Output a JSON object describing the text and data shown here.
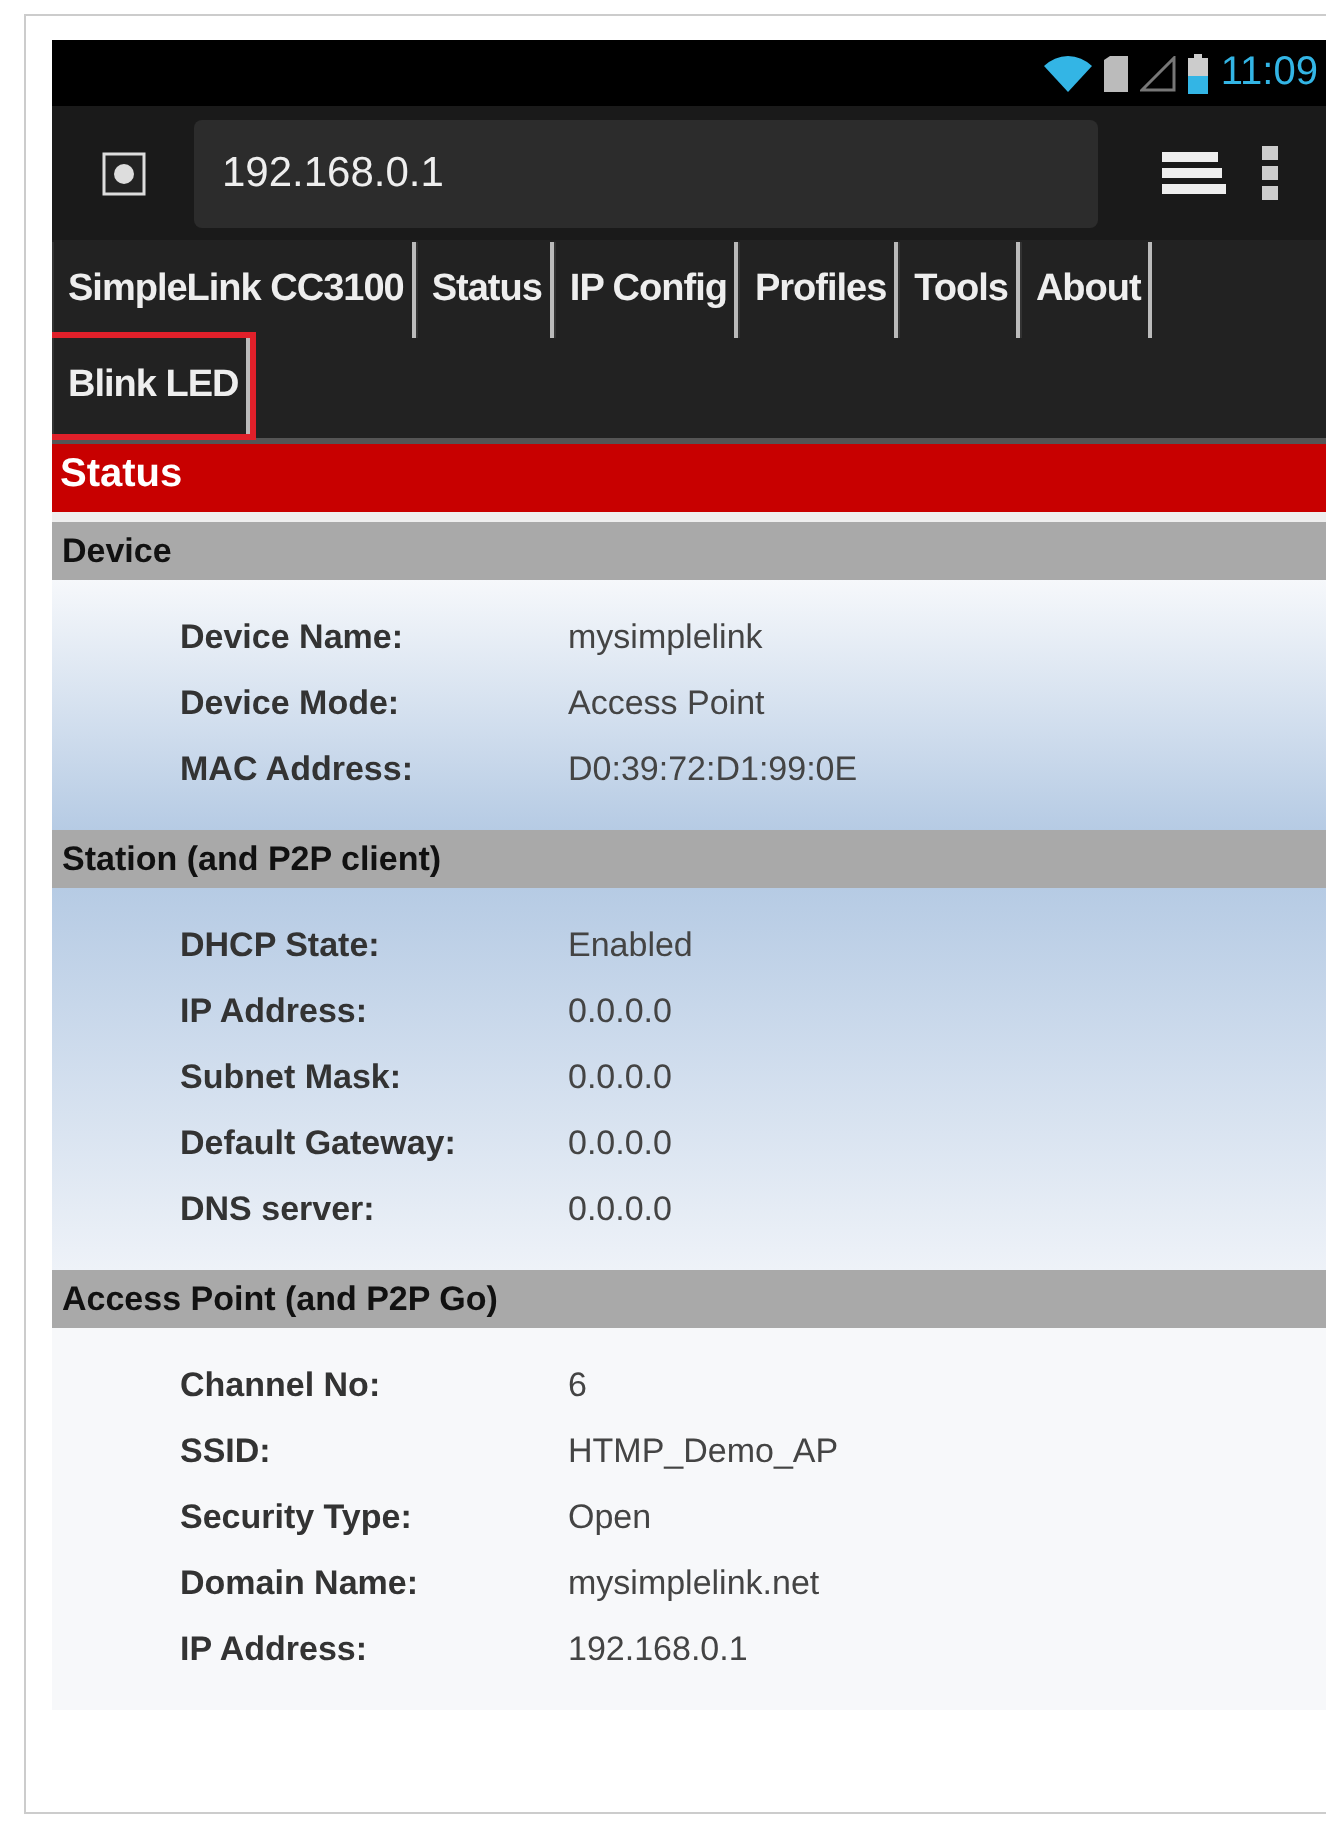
{
  "status_bar": {
    "time": "11:09"
  },
  "browser": {
    "url": "192.168.0.1"
  },
  "nav": [
    {
      "label": "SimpleLink CC3100",
      "annotated": false
    },
    {
      "label": "Status",
      "annotated": false
    },
    {
      "label": "IP Config",
      "annotated": false
    },
    {
      "label": "Profiles",
      "annotated": false
    },
    {
      "label": "Tools",
      "annotated": false
    },
    {
      "label": "About",
      "annotated": false
    },
    {
      "label": "Blink LED",
      "annotated": true
    }
  ],
  "page_title": "Status",
  "sections": [
    {
      "title": "Device",
      "kind": "fade-down",
      "rows": [
        {
          "label": "Device Name:",
          "value": "mysimplelink"
        },
        {
          "label": "Device Mode:",
          "value": "Access Point"
        },
        {
          "label": "MAC Address:",
          "value": "D0:39:72:D1:99:0E"
        }
      ]
    },
    {
      "title": "Station (and P2P client)",
      "kind": "fade-up",
      "rows": [
        {
          "label": "DHCP State:",
          "value": "Enabled"
        },
        {
          "label": "IP Address:",
          "value": "0.0.0.0"
        },
        {
          "label": "Subnet Mask:",
          "value": "0.0.0.0"
        },
        {
          "label": "Default Gateway:",
          "value": "0.0.0.0"
        },
        {
          "label": "DNS server:",
          "value": "0.0.0.0"
        }
      ]
    },
    {
      "title": "Access Point (and P2P Go)",
      "kind": "plain",
      "rows": [
        {
          "label": "Channel No:",
          "value": "6"
        },
        {
          "label": "SSID:",
          "value": "HTMP_Demo_AP"
        },
        {
          "label": "Security Type:",
          "value": "Open"
        },
        {
          "label": "Domain Name:",
          "value": "mysimplelink.net"
        },
        {
          "label": "IP Address:",
          "value": "192.168.0.1"
        }
      ]
    }
  ]
}
